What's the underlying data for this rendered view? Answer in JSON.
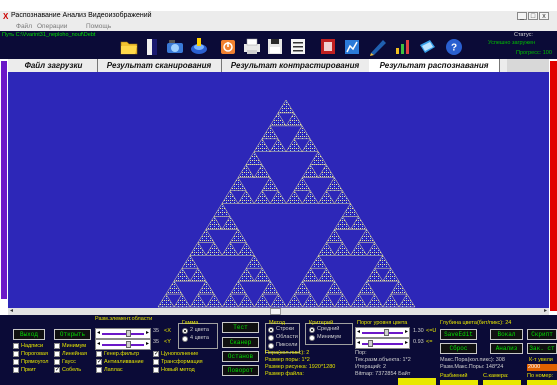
{
  "window": {
    "title": "Распознавание Анализ Видеоизображений",
    "controls": [
      "_",
      "□",
      "x"
    ]
  },
  "menu": [
    "Файл",
    "Операции",
    "Помощь"
  ],
  "toolbar": {
    "path_label": "Путь C:\\Vvarint31_neploho_nouf\\Debt",
    "icons": [
      "folder-icon",
      "document-icon",
      "camera-icon",
      "disc-icon",
      "stop-icon",
      "printer-icon",
      "save-icon",
      "list-icon",
      "film-icon",
      "chart-icon",
      "pen-icon",
      "bars-icon",
      "notebook-icon",
      "help-icon"
    ],
    "status_title": "Статус:",
    "status_value": "Успешно загружен",
    "progress_label": "Прогресс: 100"
  },
  "tabs": [
    {
      "label": "Файл загрузки",
      "active": false
    },
    {
      "label": "Результат сканирования",
      "active": false
    },
    {
      "label": "Результат контрастирования",
      "active": false
    },
    {
      "label": "Результат распознавания",
      "active": true
    }
  ],
  "colors": {
    "panel": "#0b0b37",
    "image_bg": "#2d27b8",
    "accent_green": "#00e000",
    "accent_yellow": "#e8e800",
    "accent_purple": "#6b18c8",
    "accent_red": "#e10000"
  },
  "bottom": {
    "element_size_label": "Разм.элемент.области",
    "btn_exit": "Выход",
    "btn_open": "Открыть",
    "x_value": "35",
    "x_unit": "<X",
    "y_value": "35",
    "y_unit": "<Y",
    "gamma_title": "Гамма",
    "gamma_opt1": "2 цвета",
    "gamma_opt2": "4 цвета",
    "btn_test": "Тест",
    "btn_scanner": "Сканер",
    "btn_stop": "Останов",
    "btn_rotate": "Поворот",
    "method_title": "Метод",
    "method_opt1": "Строки",
    "method_opt2": "Области",
    "method_opt3": "Пиксели",
    "criterion_title": "Критерий",
    "criterion_opt1": "Средний",
    "criterion_opt2": "Минимум",
    "threshold_label": "Порог уровня цвета",
    "threshold_v1": "1.30",
    "threshold_u1": "<=U",
    "threshold_v2": "0.93",
    "threshold_u2": "<=",
    "checks": [
      {
        "label": "Надписи",
        "checked": false
      },
      {
        "label": "Минимум",
        "checked": false
      },
      {
        "label": "Пороговая",
        "checked": false
      },
      {
        "label": "Линейная",
        "checked": false
      },
      {
        "label": "Прямоугол",
        "checked": false
      },
      {
        "label": "Гаусс",
        "checked": false
      },
      {
        "label": "Пркит",
        "checked": false
      },
      {
        "label": "Собель",
        "checked": true
      },
      {
        "label": "Генер.фильтр",
        "checked": false
      },
      {
        "label": "Антиаливвание",
        "checked": true
      },
      {
        "label": "Лаплас",
        "checked": false
      },
      {
        "label": "Цунополнение",
        "checked": true
      },
      {
        "label": "Трансформация",
        "checked": false
      },
      {
        "label": "Новый метод",
        "checked": false
      }
    ],
    "pore_area": "Пора(кол.пикс): 2",
    "pore_size": "Размер поры: 1*2",
    "image_size": "Размер рисунка: 1920*1280",
    "file_size": "Размер файла:",
    "pore_title": "Пор:",
    "cur_size": "Тек.разм.объекта: 1*2",
    "iterations": "Итераций: 2",
    "bitmap": "Bitmap: 7372854 Байт",
    "depth": "Глубина цвета(бит/пикс): 24",
    "btn_save": "SaveEdit",
    "btn_stack": "Вокал",
    "btn_script": "Скрипт",
    "btn_reset": "Сброс",
    "btn_analysis": "Анализ",
    "btn_ext": "Зак. ст",
    "max_pore": "Макс.Пора(кол.пикс): 308",
    "max_pore_size": "Разм.Макс.Поры: 148*24",
    "k_label": "К-т увели",
    "k_value": "2000",
    "split_label": "Разбиений",
    "camera_label": "С.камера:",
    "number_label": "По номер:"
  }
}
